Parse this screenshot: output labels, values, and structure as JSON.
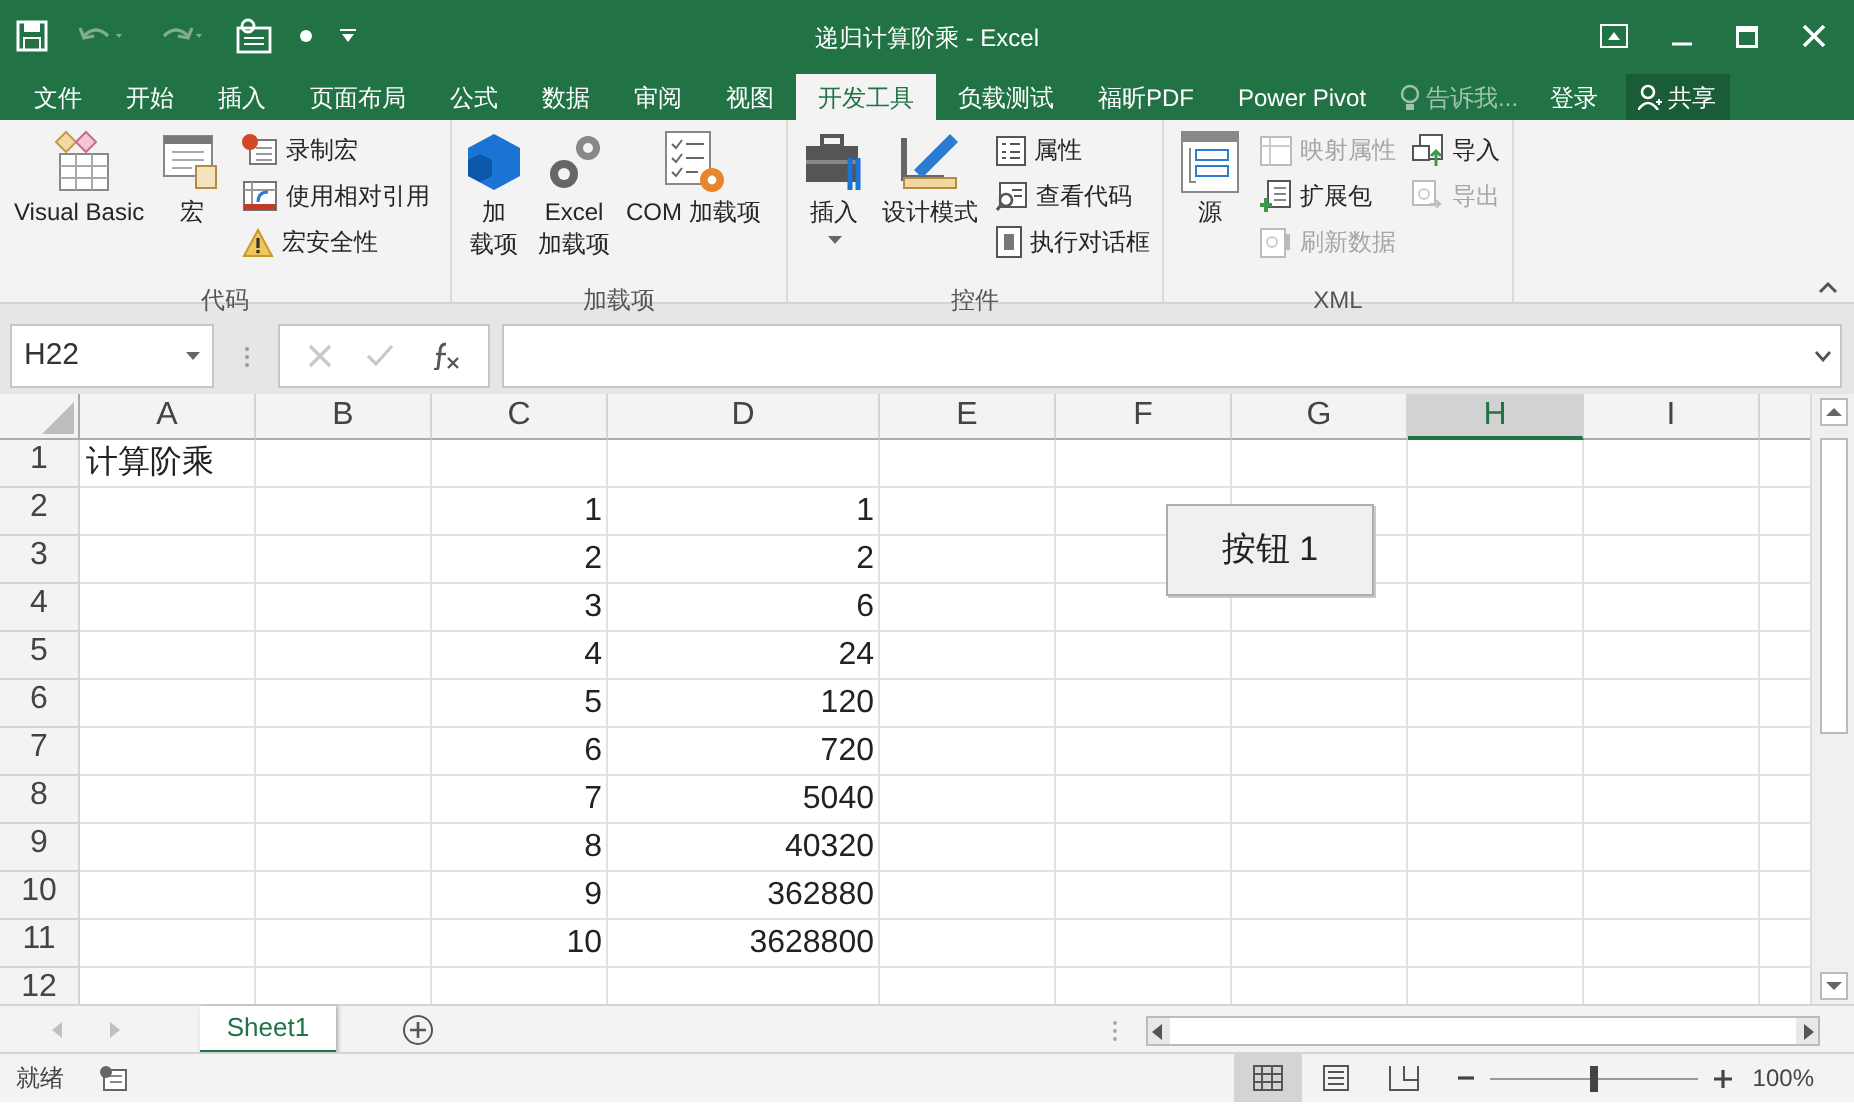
{
  "window": {
    "title": "递归计算阶乘 - Excel"
  },
  "ribbon_tabs": [
    {
      "label": "文件",
      "selected": false
    },
    {
      "label": "开始",
      "selected": false
    },
    {
      "label": "插入",
      "selected": false
    },
    {
      "label": "页面布局",
      "selected": false
    },
    {
      "label": "公式",
      "selected": false
    },
    {
      "label": "数据",
      "selected": false
    },
    {
      "label": "审阅",
      "selected": false
    },
    {
      "label": "视图",
      "selected": false
    },
    {
      "label": "开发工具",
      "selected": true
    },
    {
      "label": "负载测试",
      "selected": false
    },
    {
      "label": "福昕PDF",
      "selected": false
    },
    {
      "label": "Power Pivot",
      "selected": false
    }
  ],
  "tell_me": {
    "placeholder": "告诉我..."
  },
  "sign_in": "登录",
  "share": "共享",
  "ribbon_groups": [
    {
      "label": "代码",
      "items": [
        {
          "kind": "large",
          "lines": [
            "Visual Basic"
          ],
          "disabled": false
        },
        {
          "kind": "large",
          "lines": [
            "宏"
          ],
          "disabled": false
        },
        {
          "kind": "small",
          "lines": [
            "录制宏"
          ],
          "disabled": false
        },
        {
          "kind": "small",
          "lines": [
            "使用相对引用"
          ],
          "disabled": false
        },
        {
          "kind": "small",
          "lines": [
            "宏安全性"
          ],
          "disabled": false
        }
      ]
    },
    {
      "label": "加载项",
      "items": [
        {
          "kind": "large",
          "lines": [
            "加",
            "载项"
          ],
          "disabled": false
        },
        {
          "kind": "large",
          "lines": [
            "Excel",
            "加载项"
          ],
          "disabled": false
        },
        {
          "kind": "large",
          "lines": [
            "COM 加载项"
          ],
          "disabled": false
        }
      ]
    },
    {
      "label": "控件",
      "items": [
        {
          "kind": "large",
          "lines": [
            "插入"
          ],
          "disabled": false,
          "dropdown": true
        },
        {
          "kind": "large",
          "lines": [
            "设计模式"
          ],
          "disabled": false
        },
        {
          "kind": "small",
          "lines": [
            "属性"
          ],
          "disabled": false
        },
        {
          "kind": "small",
          "lines": [
            "查看代码"
          ],
          "disabled": false
        },
        {
          "kind": "small",
          "lines": [
            "执行对话框"
          ],
          "disabled": false
        }
      ]
    },
    {
      "label": "XML",
      "items": [
        {
          "kind": "large",
          "lines": [
            "源"
          ],
          "disabled": false
        },
        {
          "kind": "small",
          "lines": [
            "映射属性"
          ],
          "disabled": true
        },
        {
          "kind": "small",
          "lines": [
            "扩展包"
          ],
          "disabled": false
        },
        {
          "kind": "small",
          "lines": [
            "刷新数据"
          ],
          "disabled": true
        },
        {
          "kind": "small",
          "lines": [
            "导入"
          ],
          "disabled": false
        },
        {
          "kind": "small",
          "lines": [
            "导出"
          ],
          "disabled": true
        }
      ]
    }
  ],
  "name_box": {
    "value": "H22"
  },
  "columns": [
    {
      "label": "A",
      "selected": false
    },
    {
      "label": "B",
      "selected": false
    },
    {
      "label": "C",
      "selected": false
    },
    {
      "label": "D",
      "selected": false
    },
    {
      "label": "E",
      "selected": false
    },
    {
      "label": "F",
      "selected": false
    },
    {
      "label": "G",
      "selected": false
    },
    {
      "label": "H",
      "selected": true
    },
    {
      "label": "I",
      "selected": false
    }
  ],
  "rows": [
    {
      "number": "1",
      "cells": {
        "A": "计算阶乘"
      }
    },
    {
      "number": "2",
      "cells": {
        "C": "1",
        "D": "1"
      }
    },
    {
      "number": "3",
      "cells": {
        "C": "2",
        "D": "2"
      }
    },
    {
      "number": "4",
      "cells": {
        "C": "3",
        "D": "6"
      }
    },
    {
      "number": "5",
      "cells": {
        "C": "4",
        "D": "24"
      }
    },
    {
      "number": "6",
      "cells": {
        "C": "5",
        "D": "120"
      }
    },
    {
      "number": "7",
      "cells": {
        "C": "6",
        "D": "720"
      }
    },
    {
      "number": "8",
      "cells": {
        "C": "7",
        "D": "5040"
      }
    },
    {
      "number": "9",
      "cells": {
        "C": "8",
        "D": "40320"
      }
    },
    {
      "number": "10",
      "cells": {
        "C": "9",
        "D": "362880"
      }
    },
    {
      "number": "11",
      "cells": {
        "C": "10",
        "D": "3628800"
      }
    },
    {
      "number": "12",
      "cells": {}
    }
  ],
  "sheet_button": {
    "label": "按钮 1"
  },
  "sheet_tabs": [
    {
      "label": "Sheet1",
      "selected": true
    }
  ],
  "status_bar": {
    "status": "就绪",
    "views": [
      {
        "selected": true
      },
      {
        "selected": false
      },
      {
        "selected": false
      }
    ],
    "zoom": {
      "level": 0.5,
      "reading": "100%"
    }
  }
}
